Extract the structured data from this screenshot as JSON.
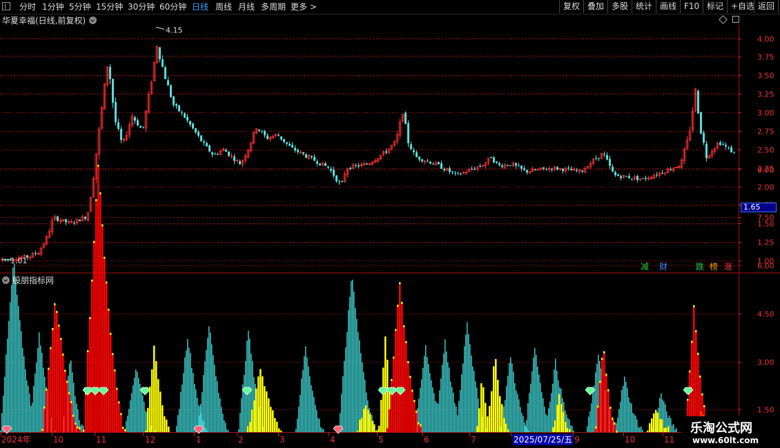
{
  "toolbar": {
    "periods": [
      "分时",
      "1分钟",
      "5分钟",
      "15分钟",
      "30分钟",
      "60分钟",
      "日线",
      "周线",
      "月线",
      "多周期",
      "更多 >"
    ],
    "active_period": "日线",
    "actions": [
      "复权",
      "叠加",
      "多股",
      "统计",
      "画线",
      "F10",
      "标记",
      "+自选",
      "返回"
    ]
  },
  "main_chart": {
    "title": "华夏幸福(日线,前复权)",
    "high_label": "4.15",
    "low_label": "1.01",
    "current_price": "1.65",
    "y_ticks": [
      "4.00",
      "3.75",
      "3.50",
      "3.25",
      "3.00",
      "2.75",
      "2.50",
      "2.25",
      "2.00",
      "1.75",
      "1.50",
      "1.25",
      "1.00"
    ],
    "tags": [
      {
        "text": "减",
        "color": "#22cc44"
      },
      {
        "text": "财",
        "color": "#3a8cff"
      },
      {
        "text": "跌",
        "color": "#22cc44"
      },
      {
        "text": "榜",
        "color": "#ff9900"
      },
      {
        "text": "涨",
        "color": "#ff3333"
      }
    ],
    "colors": {
      "up": "#ff3333",
      "down": "#55dddd",
      "grid": "#7a1010"
    }
  },
  "indicator": {
    "title": "股朋指标网",
    "y_ticks": [
      "9.00",
      "7.50",
      "6.00",
      "4.50",
      "3.00",
      "1.50"
    ],
    "colors": {
      "cyan": "#3cc8c8",
      "red": "#ff0000",
      "yellow": "#ffff00",
      "gem_green": "#66ff99",
      "gem_red": "#ff6677"
    }
  },
  "x_axis": {
    "labels": [
      "2024年",
      "10",
      "11",
      "12",
      "1",
      "2",
      "3",
      "4",
      "5",
      "6",
      "7",
      "9",
      "10",
      "11"
    ],
    "cursor_date": "2025/07/25/五"
  },
  "watermark": {
    "line1": "乐淘公式网",
    "line2": "www.60lt.com"
  },
  "chart_data": {
    "type": "candlestick",
    "title": "华夏幸福(日线,前复权)",
    "ylim": [
      0.85,
      4.25
    ],
    "price_path": [
      [
        0,
        1.01
      ],
      [
        40,
        1.05
      ],
      [
        55,
        1.12
      ],
      [
        66,
        1.3
      ],
      [
        76,
        1.58
      ],
      [
        100,
        1.5
      ],
      [
        125,
        1.6
      ],
      [
        132,
        2.0
      ],
      [
        140,
        2.6
      ],
      [
        148,
        3.2
      ],
      [
        155,
        3.7
      ],
      [
        165,
        2.9
      ],
      [
        176,
        2.55
      ],
      [
        190,
        2.95
      ],
      [
        205,
        2.75
      ],
      [
        213,
        3.15
      ],
      [
        226,
        3.9
      ],
      [
        237,
        3.5
      ],
      [
        250,
        3.1
      ],
      [
        265,
        2.95
      ],
      [
        280,
        2.75
      ],
      [
        295,
        2.55
      ],
      [
        308,
        2.42
      ],
      [
        322,
        2.5
      ],
      [
        347,
        2.3
      ],
      [
        360,
        2.55
      ],
      [
        370,
        2.8
      ],
      [
        385,
        2.65
      ],
      [
        400,
        2.7
      ],
      [
        420,
        2.52
      ],
      [
        440,
        2.42
      ],
      [
        475,
        2.25
      ],
      [
        493,
        2.0
      ],
      [
        500,
        2.25
      ],
      [
        530,
        2.3
      ],
      [
        555,
        2.45
      ],
      [
        572,
        2.6
      ],
      [
        582,
        3.0
      ],
      [
        590,
        2.6
      ],
      [
        600,
        2.4
      ],
      [
        630,
        2.3
      ],
      [
        660,
        2.15
      ],
      [
        700,
        2.3
      ],
      [
        710,
        2.4
      ],
      [
        720,
        2.28
      ],
      [
        740,
        2.3
      ],
      [
        760,
        2.2
      ],
      [
        800,
        2.25
      ],
      [
        840,
        2.2
      ],
      [
        858,
        2.35
      ],
      [
        872,
        2.45
      ],
      [
        888,
        2.15
      ],
      [
        930,
        2.1
      ],
      [
        960,
        2.2
      ],
      [
        985,
        2.3
      ],
      [
        997,
        2.7
      ],
      [
        1006,
        3.3
      ],
      [
        1014,
        2.75
      ],
      [
        1022,
        2.4
      ],
      [
        1040,
        2.6
      ],
      [
        1062,
        2.45
      ]
    ],
    "indicator": {
      "ylim": [
        0.8,
        9.6
      ],
      "cyan_waves": [
        [
          0,
          6.2,
          55
        ],
        [
          42,
          3.9,
          40
        ],
        [
          90,
          3.2,
          30
        ],
        [
          180,
          2.8,
          45
        ],
        [
          255,
          3.8,
          45
        ],
        [
          286,
          4.2,
          45
        ],
        [
          345,
          4.0,
          40
        ],
        [
          428,
          3.5,
          40
        ],
        [
          490,
          5.8,
          55
        ],
        [
          600,
          3.5,
          45
        ],
        [
          630,
          3.7,
          40
        ],
        [
          660,
          4.3,
          45
        ],
        [
          725,
          3.2,
          40
        ],
        [
          760,
          3.5,
          40
        ],
        [
          790,
          3.0,
          40
        ],
        [
          850,
          3.2,
          45
        ],
        [
          890,
          2.5,
          40
        ],
        [
          945,
          2.0,
          35
        ]
      ],
      "red_waves": [
        [
          60,
          5.0,
          55
        ],
        [
          120,
          9.2,
          60
        ],
        [
          560,
          5.5,
          50
        ],
        [
          862,
          3.5,
          30
        ],
        [
          992,
          4.7,
          35
        ]
      ],
      "yellow_waves": [
        [
          210,
          3.5,
          35
        ],
        [
          358,
          2.8,
          50
        ],
        [
          517,
          1.7,
          30
        ],
        [
          548,
          3.8,
          25
        ],
        [
          690,
          2.5,
          20
        ],
        [
          705,
          3.2,
          30
        ],
        [
          800,
          1.9,
          25
        ],
        [
          937,
          1.6,
          30
        ],
        [
          1005,
          1.4,
          25
        ]
      ],
      "green_gems": [
        127,
        138,
        150,
        210,
        358,
        555,
        568,
        580,
        855,
        997
      ],
      "red_gems": [
        10,
        288,
        490
      ]
    }
  }
}
